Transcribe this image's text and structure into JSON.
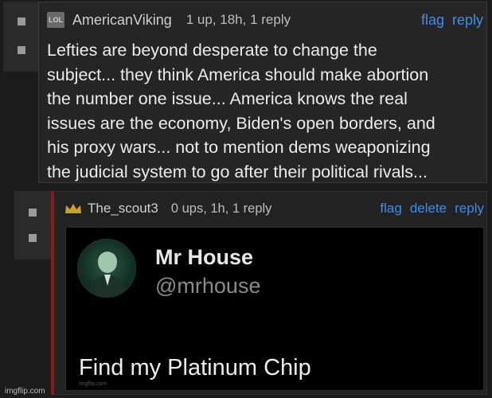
{
  "comment1": {
    "badge": "LOL",
    "username": "AmericanViking",
    "meta": "1 up, 18h, 1 reply",
    "actions": {
      "flag": "flag",
      "reply": "reply"
    },
    "lines": [
      "Lefties are beyond desperate to change the",
      "subject... they think America should make abortion",
      "the number one issue... America knows the real",
      "issues are the economy, Biden's open borders, and",
      "his proxy wars... not to mention dems weaponizing",
      "the judicial system to go after their political rivals..."
    ]
  },
  "comment2": {
    "username": "The_scout3",
    "meta": "0 ups, 1h, 1 reply",
    "actions": {
      "flag": "flag",
      "delete": "delete",
      "reply": "reply"
    },
    "tweet": {
      "name": "Mr House",
      "handle": "@mrhouse",
      "text": "Find my Platinum Chip",
      "watermark": "imgflip.com"
    }
  },
  "footer": {
    "watermark": "imgflip.com"
  },
  "colors": {
    "link": "#3d8df0",
    "accent_border": "#8b1a1a",
    "crown": "#c9a227"
  }
}
